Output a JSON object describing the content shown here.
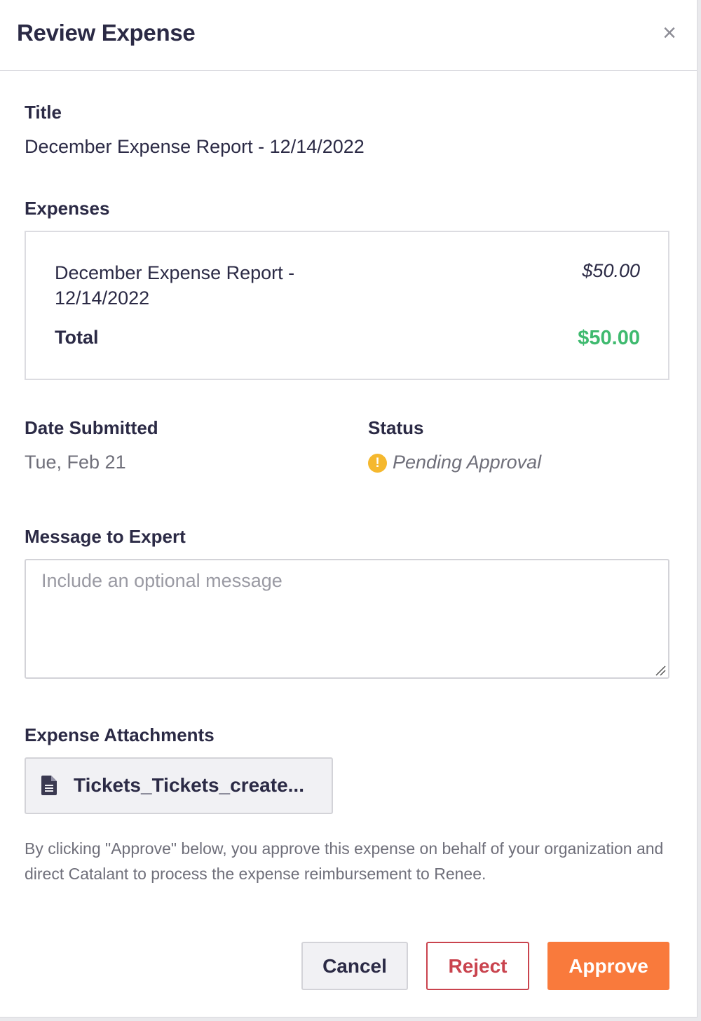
{
  "modal": {
    "title": "Review Expense",
    "close_icon": "close-icon"
  },
  "title_section": {
    "label": "Title",
    "value": "December Expense Report - 12/14/2022"
  },
  "expenses": {
    "label": "Expenses",
    "items": [
      {
        "description": "December Expense Report - 12/14/2022",
        "amount": "$50.00"
      }
    ],
    "total_label": "Total",
    "total_amount": "$50.00",
    "total_color": "#3fba6f"
  },
  "date_submitted": {
    "label": "Date Submitted",
    "value": "Tue, Feb 21"
  },
  "status": {
    "label": "Status",
    "icon": "warning-icon",
    "icon_color": "#f5b82e",
    "value": "Pending Approval"
  },
  "message": {
    "label": "Message to Expert",
    "placeholder": "Include an optional message",
    "value": ""
  },
  "attachments": {
    "label": "Expense Attachments",
    "items": [
      {
        "icon": "file-icon",
        "name": "Tickets_Tickets_create..."
      }
    ]
  },
  "disclaimer": "By clicking \"Approve\" below, you approve this expense on behalf of your organization and direct Catalant to process the expense reimbursement to Renee.",
  "actions": {
    "cancel_label": "Cancel",
    "reject_label": "Reject",
    "approve_label": "Approve",
    "approve_color": "#f97a3c",
    "reject_color": "#c9434e"
  }
}
